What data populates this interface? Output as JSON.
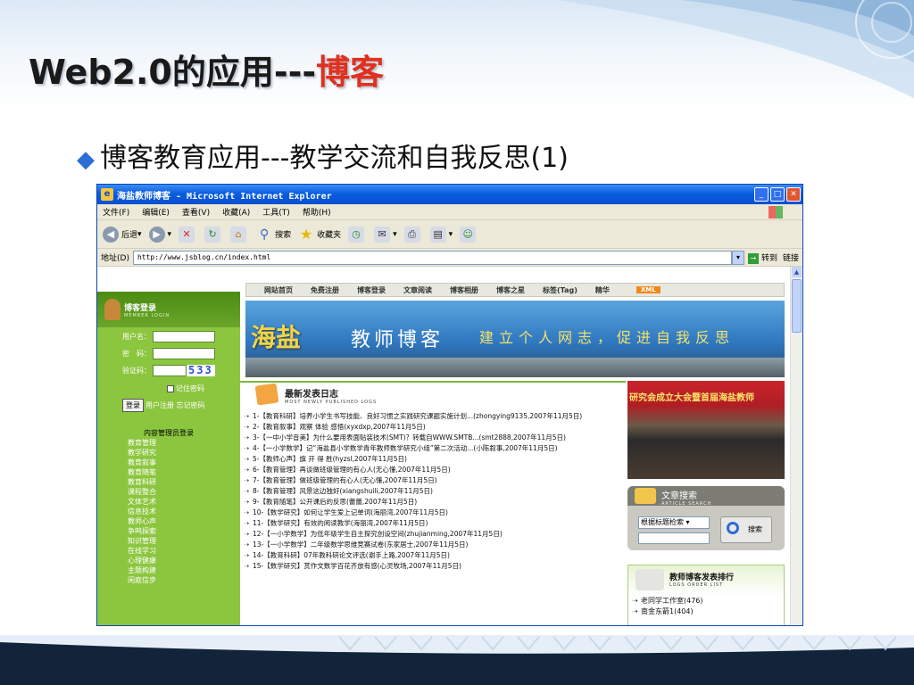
{
  "slide": {
    "title_black": "Web2.0的应用---",
    "title_red": "博客",
    "bullet": "博客教育应用---教学交流和自我反思(1)"
  },
  "browser": {
    "window_title": "海盐教师博客 - Microsoft Internet Explorer",
    "menu": [
      "文件(F)",
      "编辑(E)",
      "查看(V)",
      "收藏(A)",
      "工具(T)",
      "帮助(H)"
    ],
    "toolbar": {
      "back": "后退",
      "search": "搜索",
      "favorites": "收藏夹"
    },
    "address_label": "地址(D)",
    "address_url": "http://www.jsblog.cn/index.html",
    "go_label": "转到",
    "links_label": "链接"
  },
  "site": {
    "nav": [
      "网站首页",
      "免费注册",
      "博客登录",
      "文章阅读",
      "博客相册",
      "博客之星",
      "标签(Tag)",
      "精华"
    ],
    "xml_badge": "XML",
    "banner": {
      "title": "海盐",
      "subtitle": "教师博客",
      "slogan": "建立个人网志，促进自我反思"
    },
    "login": {
      "title": "博客登录",
      "title_en": "MEMBER LOGIN",
      "username_label": "用户名：",
      "password_label": "密　码：",
      "captcha_label": "验证码：",
      "captcha_value": "533",
      "remember": "记住密码",
      "login_button": "登录",
      "register": "用户注册",
      "forgot": "忘记密码",
      "admin_login": "内容管理员登录"
    },
    "categories": [
      "教育管理",
      "教学研究",
      "教育叙事",
      "教育随笔",
      "教育科研",
      "课程整合",
      "文体艺术",
      "信息技术",
      "教师心声",
      "争鸣探索",
      "知识管理",
      "在线学习",
      "心理健康",
      "主题构建",
      "闲庭信步"
    ],
    "recent": {
      "title": "最新发表日志",
      "title_en": "MOST NEWLY PUBLISHED LOGS",
      "posts": [
        "1-【教育科研】培养小学生书写技能、良好习惯之实践研究课题实施计划...(zhongying9135,2007年11月5日)",
        "2-【教育叙事】观察 体验 感悟(xyxdxp,2007年11月5日)",
        "3-【一中小学音美】为什么要用表面贴装技术(SMT)？转载自WWW.SMTB...(smt2888,2007年11月5日)",
        "4-【一小学数学】记“海盐县小学数学青年教师数学研究小组”第二次活动...(小陈叙事,2007年11月5日)",
        "5-【教师心声】旗 开 得 胜(hyzsl,2007年11月5日)",
        "6-【教育管理】再谈做班级管理的有心人(无心懂,2007年11月5日)",
        "7-【教育管理】做班级管理的有心人(无心懂,2007年11月5日)",
        "8-【教育管理】风景这边独好(xiangshuili,2007年11月5日)",
        "9-【教育随笔】公开课后的反思(蕾蕾,2007年11月5日)",
        "10-【数学研究】如何让学生爱上记单词(海丽湾,2007年11月5日)",
        "11-【数学研究】有效的阅读教学(海丽湾,2007年11月5日)",
        "12-【一小学数学】为低年级学生自主探究创设空间(zhujianming,2007年11月5日)",
        "13-【一小学数学】二年级数学思维竞赛试卷(东家居士,2007年11月5日)",
        "14-【教育科研】07年教科研论文评选(谢手上路,2007年11月5日)",
        "15-【数学研究】赏作文数学百花齐放有感(心灵牧场,2007年11月5日)"
      ]
    },
    "photo_caption": "研究会成立大会暨首届海盐教师",
    "search": {
      "title": "文章搜索",
      "title_en": "ARTICLE SEARCH",
      "select_value": "根据标题检索",
      "button": "搜索"
    },
    "ranking": {
      "title": "教师博客发表排行",
      "title_en": "LOGS ORDER LIST",
      "items": [
        "老同学工作室(476)",
        "南金东箭1(404)"
      ]
    }
  }
}
